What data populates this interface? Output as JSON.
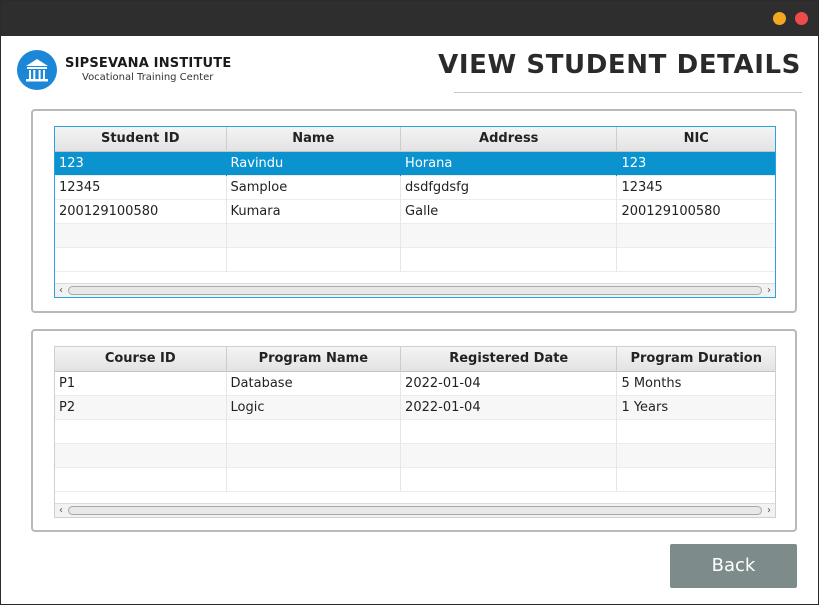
{
  "brand": {
    "name": "SIPSEVANA INSTITUTE",
    "subtitle": "Vocational Training Center"
  },
  "page": {
    "title": "VIEW STUDENT DETAILS"
  },
  "students_table": {
    "columns": [
      "Student ID",
      "Name",
      "Address",
      "NIC"
    ],
    "rows": [
      [
        "123",
        "Ravindu",
        "Horana",
        "123"
      ],
      [
        "12345",
        "Samploe",
        "dsdfgdsfg",
        "12345"
      ],
      [
        "200129100580",
        "Kumara",
        "Galle",
        "200129100580"
      ]
    ],
    "selected_row": 0
  },
  "courses_table": {
    "columns": [
      "Course ID",
      "Program Name",
      "Registered Date",
      "Program Duration"
    ],
    "rows": [
      [
        "P1",
        "Database",
        "2022-01-04",
        "5 Months"
      ],
      [
        "P2",
        "Logic",
        "2022-01-04",
        "1 Years"
      ]
    ]
  },
  "actions": {
    "back_label": "Back"
  },
  "colors": {
    "accent": "#0a93cf",
    "logo": "#1b87d6",
    "button": "#7d8c8a",
    "window_min": "#f3a81f",
    "window_close": "#ee4c4c"
  }
}
